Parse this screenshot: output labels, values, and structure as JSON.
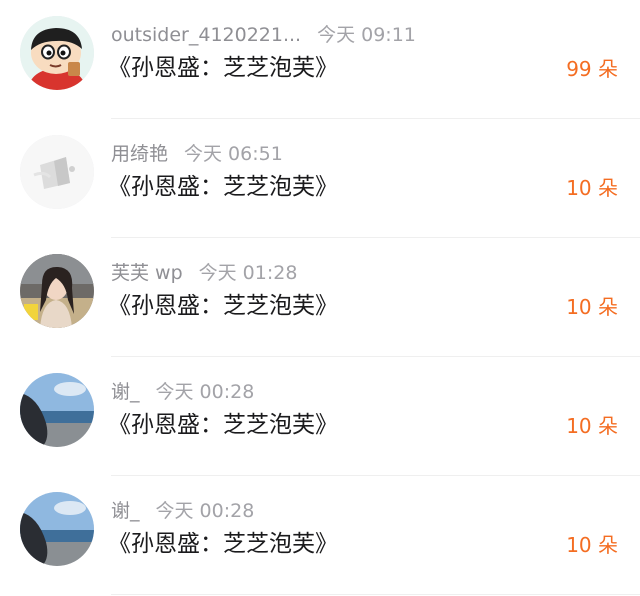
{
  "gift_list": {
    "items": [
      {
        "avatar_icon": "cartoon-boy-avatar-icon",
        "username": "outsider_4120221...",
        "time": "今天 09:11",
        "title": "《孙恩盛：芝芝泡芙》",
        "count": "99 朵"
      },
      {
        "avatar_icon": "pale-object-avatar-icon",
        "username": "用绮艳",
        "time": "今天 06:51",
        "title": "《孙恩盛：芝芝泡芙》",
        "count": "10 朵"
      },
      {
        "avatar_icon": "girl-photo-avatar-icon",
        "username": "芙芙 wp",
        "time": "今天 01:28",
        "title": "《孙恩盛：芝芝泡芙》",
        "count": "10 朵"
      },
      {
        "avatar_icon": "seaside-photo-avatar-icon",
        "username": "谢_",
        "time": "今天 00:28",
        "title": "《孙恩盛：芝芝泡芙》",
        "count": "10 朵"
      },
      {
        "avatar_icon": "seaside-photo-avatar-icon",
        "username": "谢_",
        "time": "今天 00:28",
        "title": "《孙恩盛：芝芝泡芙》",
        "count": "10 朵"
      }
    ]
  },
  "colors": {
    "count_accent": "#f46d22",
    "username": "#8f8f94",
    "title": "#1b1b1d",
    "divider": "#efefef"
  }
}
